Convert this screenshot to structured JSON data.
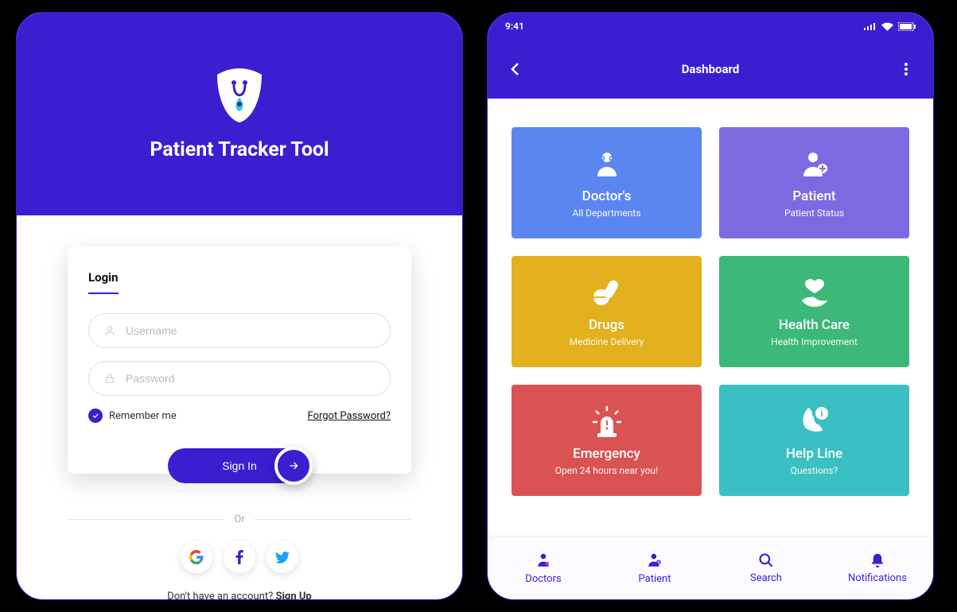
{
  "login": {
    "app_title": "Patient Tracker Tool",
    "tab_label": "Login",
    "username_placeholder": "Username",
    "password_placeholder": "Password",
    "remember_label": "Remember me",
    "forgot_label": "Forgot Password?",
    "signin_label": "Sign In",
    "or_label": "Or",
    "signup_prompt": "Don't have an account? ",
    "signup_action": "Sign Up"
  },
  "dashboard": {
    "time": "9:41",
    "title": "Dashboard",
    "tiles": [
      {
        "title": "Doctor's",
        "sub": "All Departments",
        "color": "#5b86f0"
      },
      {
        "title": "Patient",
        "sub": "Patient Status",
        "color": "#7e6ae0"
      },
      {
        "title": "Drugs",
        "sub": "Medicine Delivery",
        "color": "#e3b01e"
      },
      {
        "title": "Health Care",
        "sub": "Health Improvement",
        "color": "#3cb878"
      },
      {
        "title": "Emergency",
        "sub": "Open 24 hours near you!",
        "color": "#da5353"
      },
      {
        "title": "Help Line",
        "sub": "Questions?",
        "color": "#3abfc2"
      }
    ],
    "bottom_nav": [
      {
        "label": "Doctors"
      },
      {
        "label": "Patient"
      },
      {
        "label": "Search"
      },
      {
        "label": "Notifications"
      }
    ]
  }
}
